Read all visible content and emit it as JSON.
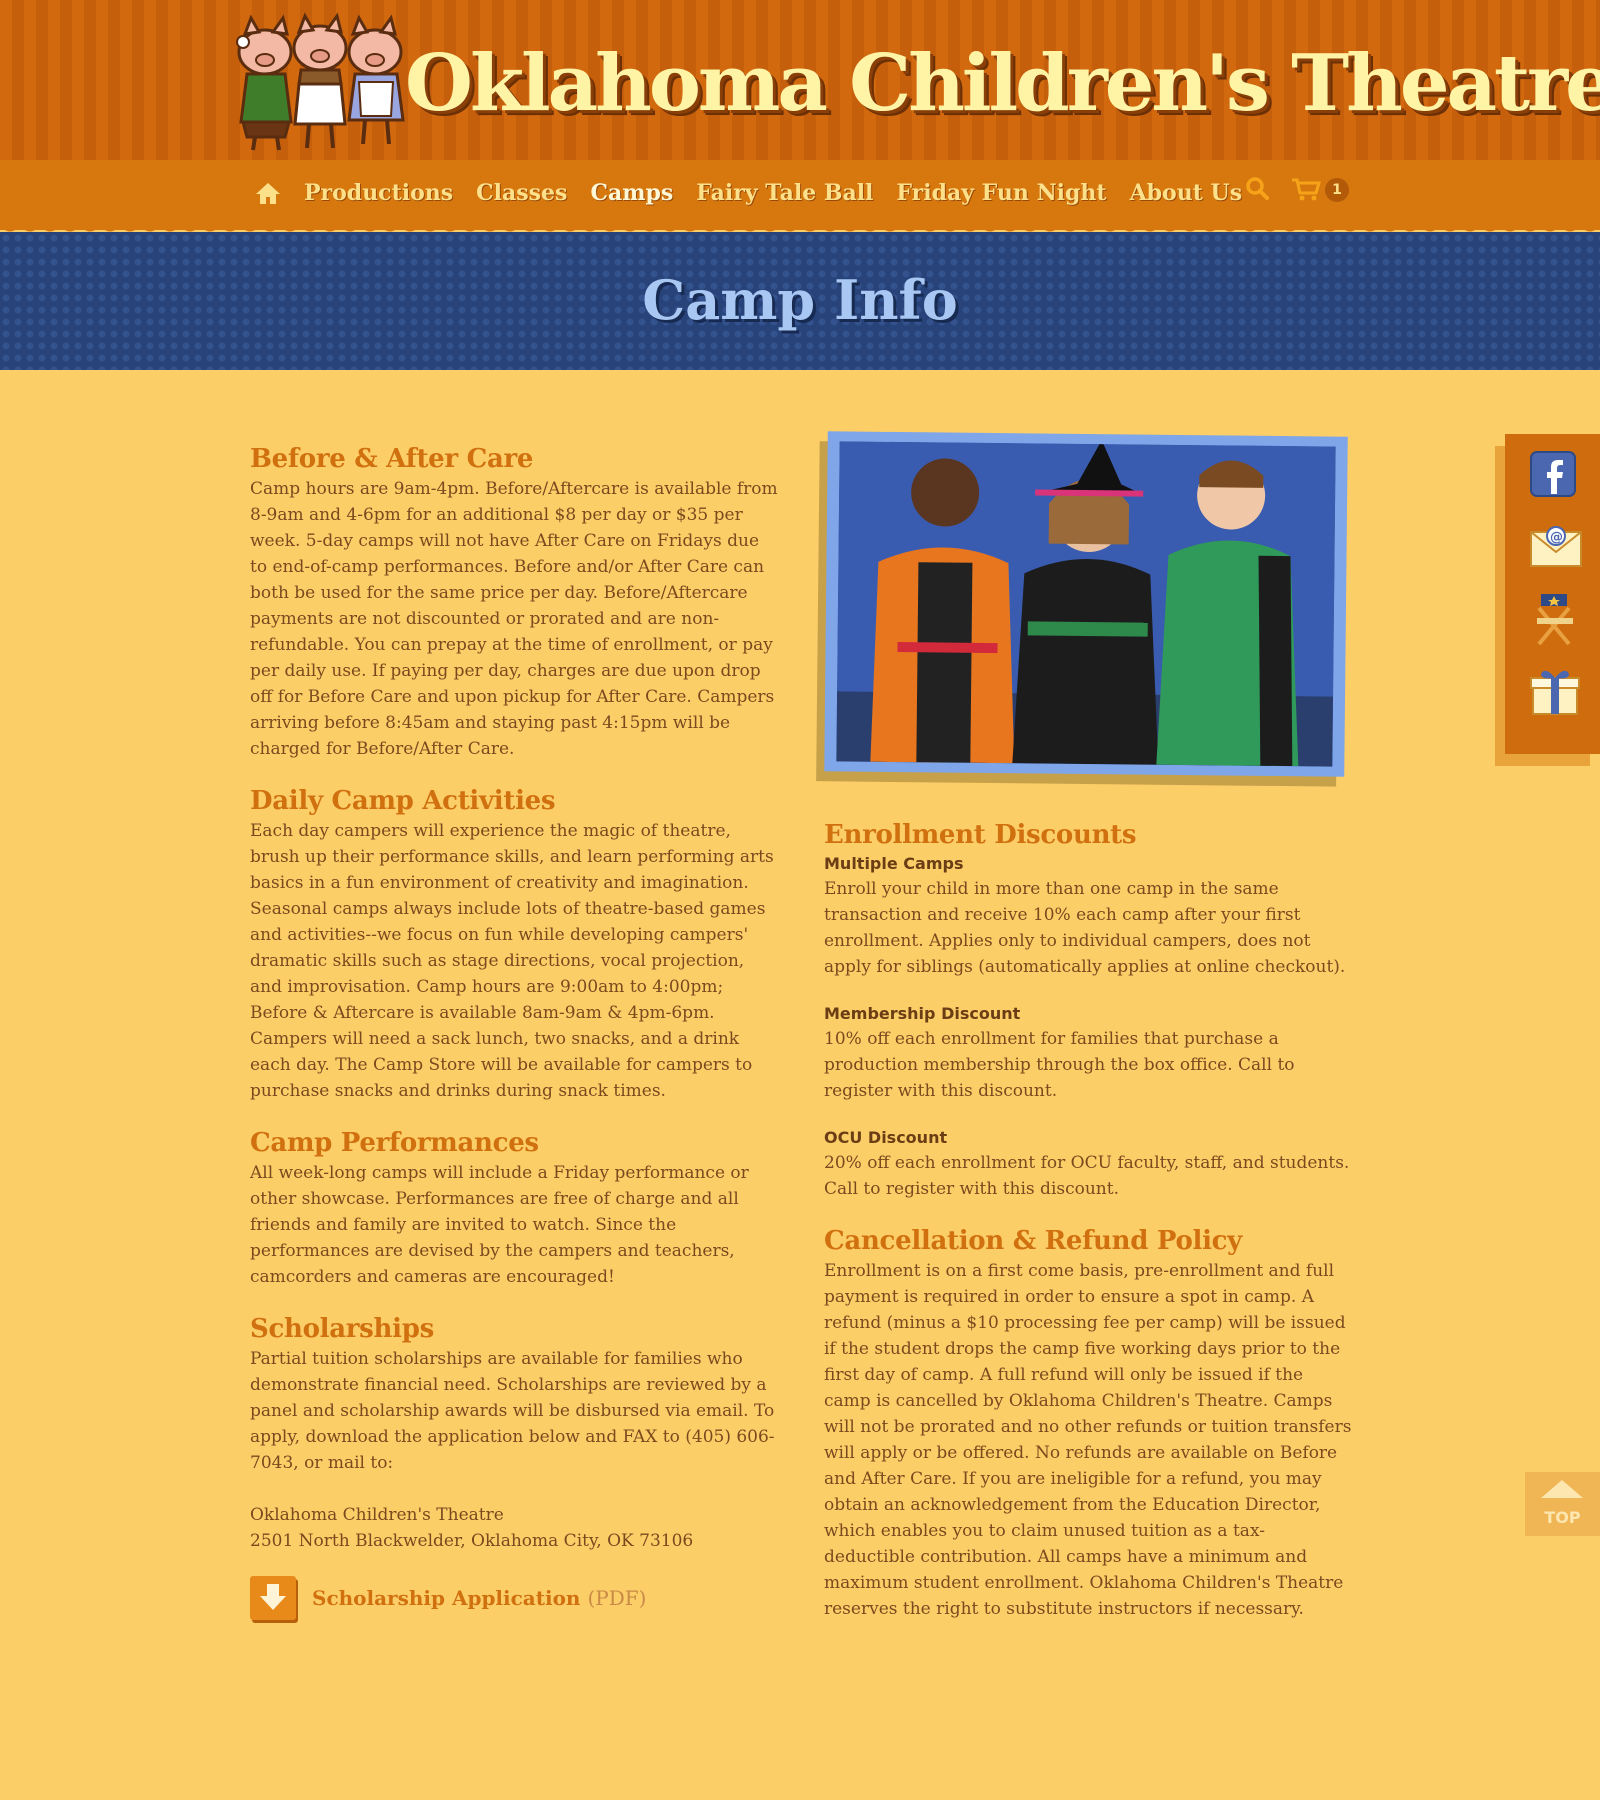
{
  "site": {
    "logo_text": "Oklahoma Children's Theatre"
  },
  "nav": {
    "items": [
      {
        "label": "Productions"
      },
      {
        "label": "Classes"
      },
      {
        "label": "Camps"
      },
      {
        "label": "Fairy Tale Ball"
      },
      {
        "label": "Friday Fun Night"
      },
      {
        "label": "About Us"
      }
    ],
    "active": "Camps",
    "cart_count": "1",
    "icons": [
      "home-icon",
      "search-icon",
      "cart-icon"
    ]
  },
  "banner": {
    "title": "Camp Info"
  },
  "left": {
    "before_after": {
      "title": "Before & After Care",
      "text": "Camp hours are 9am-4pm. Before/Aftercare is available from 8-9am and 4-6pm for an additional $8 per day or $35 per week. 5-day camps will not have After Care on Fridays due to end-of-camp performances. Before and/or After Care can both be used for the same price per day. Before/Aftercare payments are not discounted or prorated and are non-refundable. You can prepay at the time of enrollment, or pay per daily use. If paying per day, charges are due upon drop off for Before Care and upon pickup for After Care. Campers arriving before 8:45am and staying past 4:15pm will be charged for Before/After Care."
    },
    "daily": {
      "title": "Daily Camp Activities",
      "text": "Each day campers will experience the magic of theatre, brush up their performance skills, and learn performing arts basics in a fun environment of creativity and imagination. Seasonal camps always include lots of theatre-based games and activities--we focus on fun while developing campers' dramatic skills such as stage directions, vocal projection, and improvisation. Camp hours are 9:00am to 4:00pm; Before & Aftercare is available 8am-9am & 4pm-6pm. Campers will need a sack lunch, two snacks, and a drink each day. The Camp Store will be available for campers to purchase snacks and drinks during snack times."
    },
    "performances": {
      "title": "Camp Performances",
      "text": "All week-long camps will include a Friday performance or other showcase. Performances are free of charge and all friends and family are invited to watch. Since the performances are devised by the campers and teachers, camcorders and cameras are encouraged!"
    },
    "scholarships": {
      "title": "Scholarships",
      "text": "Partial tuition scholarships are available for families who demonstrate financial need. Scholarships are reviewed by a panel and scholarship awards will be disbursed via email. To apply, download the application below and FAX to (405) 606-7043, or mail to:",
      "address_line1": "Oklahoma Children's Theatre",
      "address_line2": "2501 North Blackwelder, Oklahoma City, OK 73106",
      "download_label": "Scholarship Application",
      "download_type": "(PDF)"
    }
  },
  "right": {
    "discounts": {
      "title": "Enrollment Discounts",
      "items": [
        {
          "heading": "Multiple Camps",
          "text": "Enroll your child in more than one camp in the same transaction and receive 10% each camp after your first enrollment. Applies only to individual campers, does not apply for siblings (automatically applies at online checkout)."
        },
        {
          "heading": "Membership Discount",
          "text": "10% off each enrollment for families that purchase a production membership through the box office. Call to register with this discount."
        },
        {
          "heading": "OCU Discount",
          "text": "20% off each enrollment for OCU faculty, staff, and students. Call to register with this discount."
        }
      ]
    },
    "cancellation": {
      "title": "Cancellation & Refund Policy",
      "text": "Enrollment is on a first come basis, pre-enrollment and full payment is required in order to ensure a spot in camp. A refund (minus a $10 processing fee per camp) will be issued if the student drops the camp five working days prior to the first day of camp. A full refund will only be issued if the camp is cancelled by Oklahoma Children's Theatre. Camps will not be prorated and no other refunds or tuition transfers will apply or be offered. No refunds are available on Before and After Care. If you are ineligible for a refund, you may obtain an acknowledgement from the Education Director, which enables you to claim unused tuition as a tax-deductible contribution. All camps have a minimum and maximum student enrollment. Oklahoma Children's Theatre reserves the right to substitute instructors if necessary."
    }
  },
  "side": {
    "icons": [
      "facebook-icon",
      "email-icon",
      "directors-chair-icon",
      "gift-icon"
    ],
    "top_label": "TOP"
  },
  "colors": {
    "header": "#d2690f",
    "nav": "#d7780f",
    "banner": "#28437a",
    "banner_title": "#a8c7f2",
    "background": "#fcce68",
    "heading": "#d0700f",
    "body_text": "#7a4a1e"
  }
}
